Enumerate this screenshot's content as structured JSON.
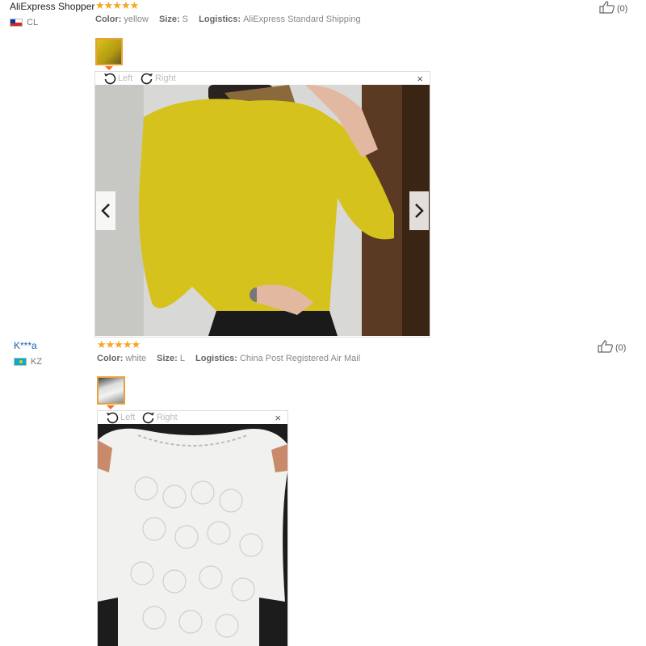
{
  "reviews": [
    {
      "name": "AliExpress Shopper",
      "country": "CL",
      "stars": "★★★★★",
      "color_label": "Color:",
      "color": "yellow",
      "size_label": "Size:",
      "size": "S",
      "logistics_label": "Logistics:",
      "logistics": "AliExpress Standard Shipping",
      "helpful": "(0)",
      "viewer": {
        "left": "Left",
        "right": "Right",
        "close": "×"
      }
    },
    {
      "name": "K***a",
      "country": "KZ",
      "stars": "★★★★★",
      "color_label": "Color:",
      "color": "white",
      "size_label": "Size:",
      "size": "L",
      "logistics_label": "Logistics:",
      "logistics": "China Post Registered Air Mail",
      "helpful": "(0)",
      "viewer": {
        "left": "Left",
        "right": "Right",
        "close": "×"
      }
    }
  ],
  "colors": {
    "star": "#f5a623",
    "thumb_border": "#e8a13a",
    "buyer_link": "#1a5fb4"
  },
  "icons": [
    "thumbs-up-icon",
    "rotate-left-icon",
    "rotate-right-icon",
    "close-icon",
    "chevron-left-icon",
    "chevron-right-icon",
    "flag-icon"
  ]
}
